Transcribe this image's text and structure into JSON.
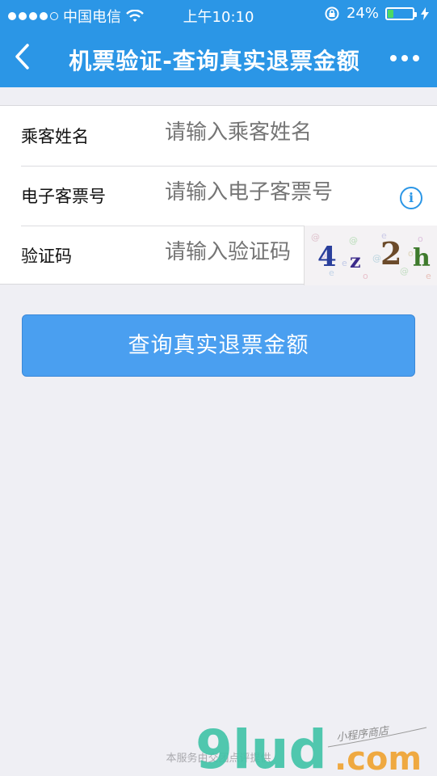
{
  "status_bar": {
    "carrier": "中国电信",
    "time": "上午10:10",
    "battery_percent": "24%",
    "battery_level": 0.24,
    "icons": [
      "signal-dots-icon",
      "wifi-icon",
      "orientation-lock-icon",
      "battery-icon",
      "charging-bolt-icon"
    ]
  },
  "nav": {
    "title": "机票验证-查询真实退票金额",
    "icons": [
      "back-chevron-icon",
      "more-dots-icon"
    ]
  },
  "form": {
    "rows": [
      {
        "label": "乘客姓名",
        "placeholder": "请输入乘客姓名"
      },
      {
        "label": "电子客票号",
        "placeholder": "请输入电子客票号"
      },
      {
        "label": "验证码",
        "placeholder": "请输入验证码"
      }
    ],
    "info_icon_glyph": "i",
    "captcha_chars": [
      "4",
      "z",
      "2",
      "h"
    ]
  },
  "query_button": {
    "label": "查询真实退票金额"
  },
  "footer": {
    "text": "本服务由交团点评提供"
  },
  "watermark": {
    "brand": "9lud",
    "suffix": ".com",
    "tagline": "小程序商店"
  },
  "colors": {
    "accent": "#2b96e6",
    "button": "#4a9ff0",
    "background": "#efeff4",
    "battery": "#4cd964"
  }
}
